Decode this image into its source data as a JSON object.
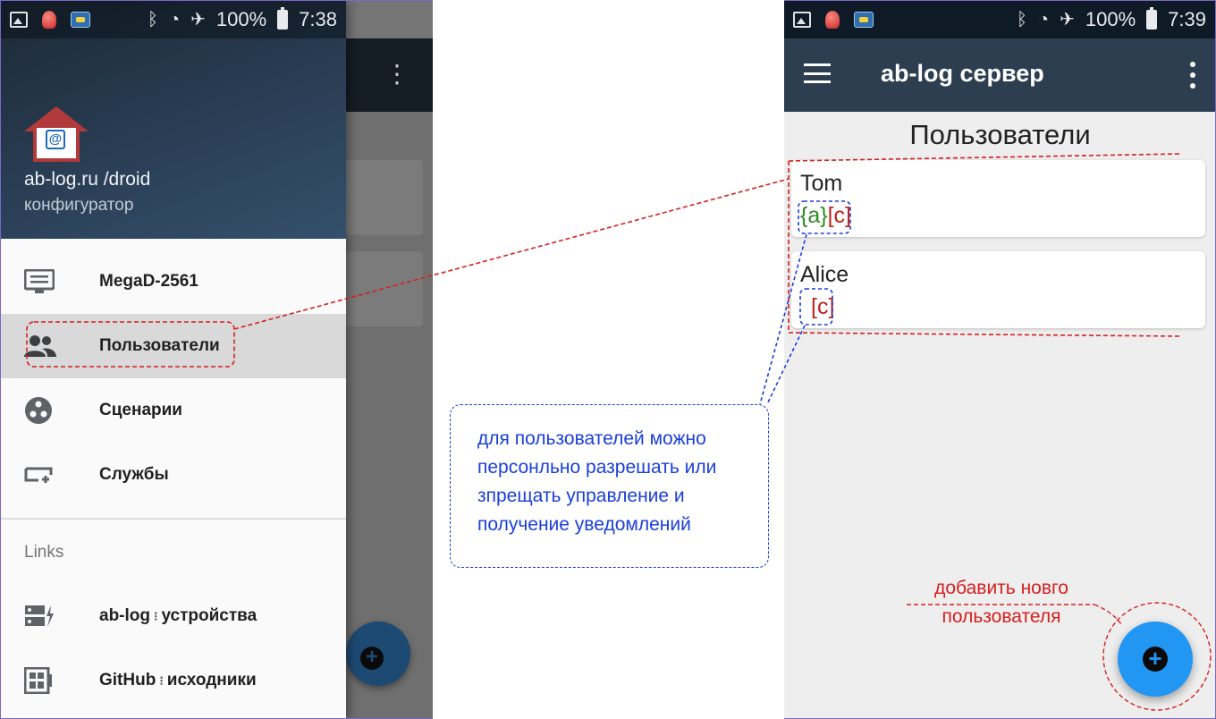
{
  "status_left": {
    "battery": "100%",
    "time": "7:38"
  },
  "status_right": {
    "battery": "100%",
    "time": "7:39"
  },
  "drawer": {
    "title": "ab-log.ru /droid",
    "subtitle": "конфигуратор",
    "items": [
      {
        "label": "MegaD-2561",
        "icon": "monitor-icon"
      },
      {
        "label": "Пользователи",
        "icon": "users-icon"
      },
      {
        "label": "Сценарии",
        "icon": "scenarios-icon"
      },
      {
        "label": "Службы",
        "icon": "services-icon"
      }
    ],
    "links_header": "Links",
    "links": [
      {
        "label_a": "ab-log",
        "label_b": "устройства",
        "icon": "devices-icon"
      },
      {
        "label_a": "GitHub",
        "label_b": "исходники",
        "icon": "github-icon"
      }
    ]
  },
  "annotation": {
    "note": "для пользователей можно персонльно разрешать или зпрещать управление и получение уведомлений",
    "fab_note": "добавить новго пользователя"
  },
  "app": {
    "title": "ab-log сервер",
    "heading": "Пользователи",
    "users": [
      {
        "name": "Tom",
        "perm_a": "{a}",
        "perm_c": "[c]"
      },
      {
        "name": "Alice",
        "perm_a": "",
        "perm_c": "[c]"
      }
    ]
  },
  "colors": {
    "toolbar": "#2c3e50",
    "fab": "#2196f3",
    "perm_allowed": "#2e8b1e",
    "perm_c": "#c0201c",
    "annotation_blue": "#1a3fd8",
    "annotation_red": "#d62020"
  }
}
